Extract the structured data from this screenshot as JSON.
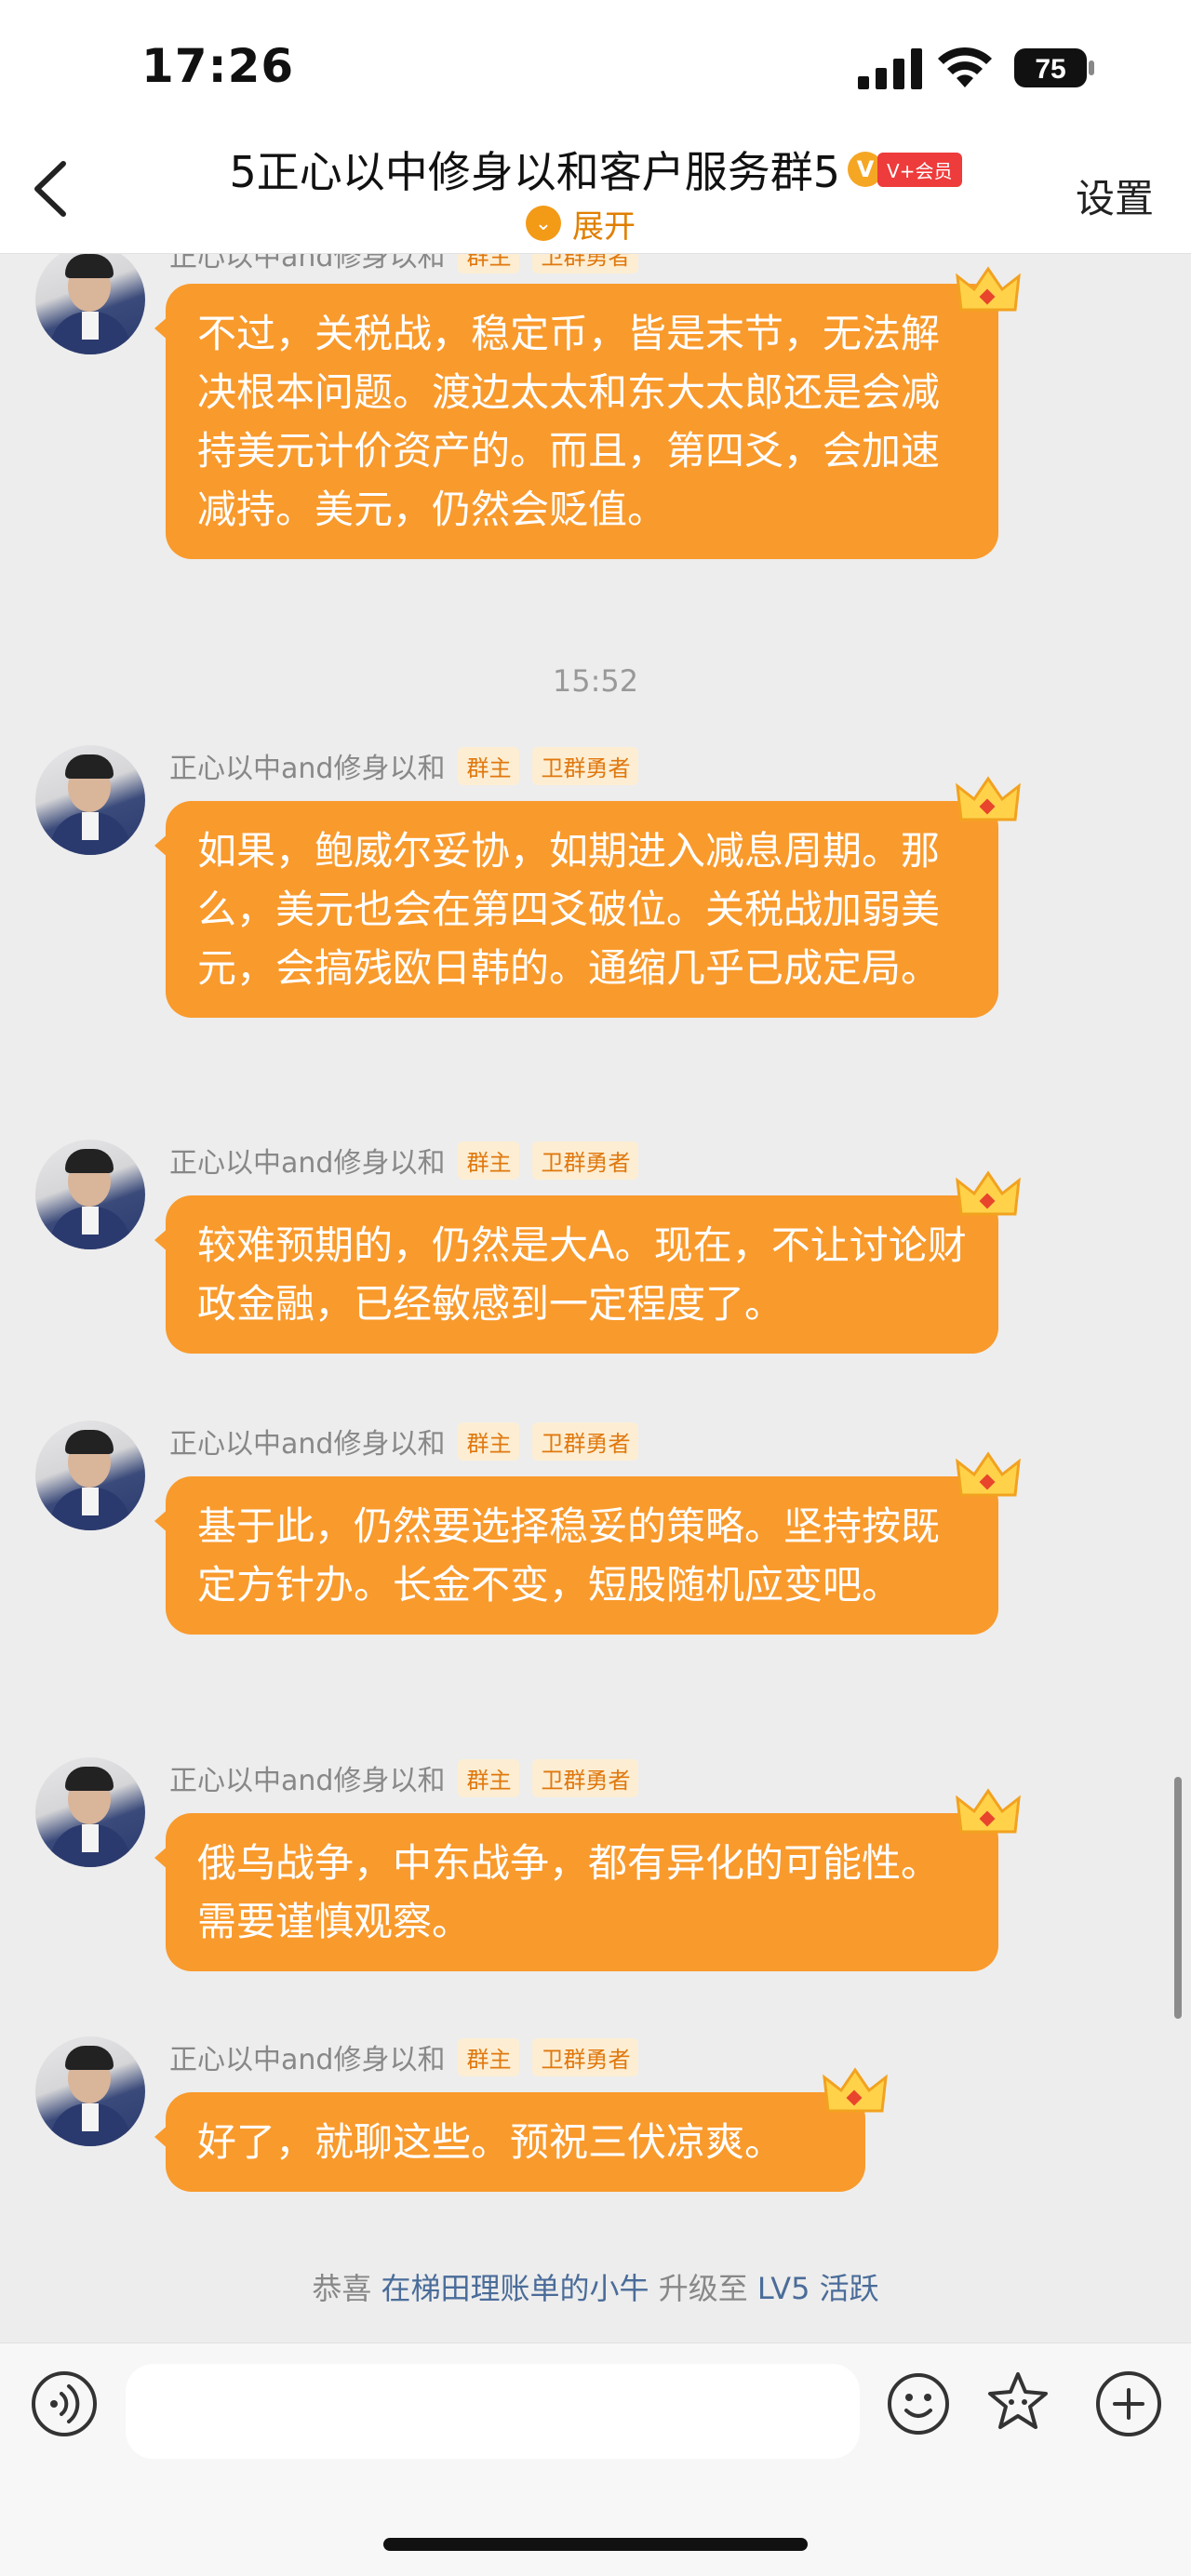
{
  "status_bar": {
    "time": "17:26",
    "battery": "75"
  },
  "nav": {
    "title": "5正心以中修身以和客户服务群5",
    "vip_label": "V+会员",
    "expand_label": "展开",
    "settings_label": "设置"
  },
  "messages": [
    {
      "name": "正心以中and修身以和",
      "tags": [
        "群主",
        "卫群勇者"
      ],
      "text": "不过，关税战，稳定币，皆是末节，无法解决根本问题。渡边太太和东大太郎还是会减持美元计价资产的。而且，第四爻，会加速减持。美元，仍然会贬值。"
    },
    {
      "name": "正心以中and修身以和",
      "tags": [
        "群主",
        "卫群勇者"
      ],
      "text": "如果，鲍威尔妥协，如期进入减息周期。那么，美元也会在第四爻破位。关税战加弱美元，会搞残欧日韩的。通缩几乎已成定局。"
    },
    {
      "name": "正心以中and修身以和",
      "tags": [
        "群主",
        "卫群勇者"
      ],
      "text": "较难预期的，仍然是大A。现在，不让讨论财政金融，已经敏感到一定程度了。"
    },
    {
      "name": "正心以中and修身以和",
      "tags": [
        "群主",
        "卫群勇者"
      ],
      "text": "基于此，仍然要选择稳妥的策略。坚持按既定方针办。长金不变，短股随机应变吧。"
    },
    {
      "name": "正心以中and修身以和",
      "tags": [
        "群主",
        "卫群勇者"
      ],
      "text": "俄乌战争，中东战争，都有异化的可能性。需要谨慎观察。"
    },
    {
      "name": "正心以中and修身以和",
      "tags": [
        "群主",
        "卫群勇者"
      ],
      "text": "好了，就聊这些。预祝三伏凉爽。"
    }
  ],
  "time_divider": "15:52",
  "system_message": {
    "prefix": "恭喜",
    "user": "在梯田理账单的小牛",
    "middle": "升级至",
    "level": "LV5 活跃"
  },
  "input": {
    "placeholder": ""
  }
}
